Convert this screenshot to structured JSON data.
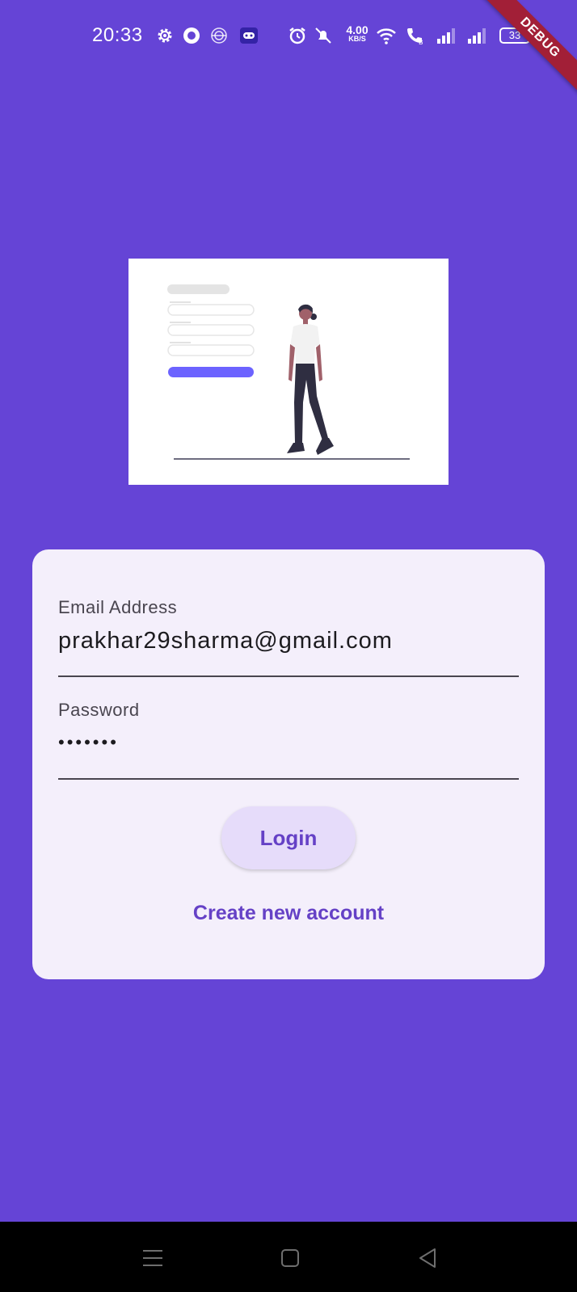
{
  "status_bar": {
    "time": "20:33",
    "net_speed_value": "4.00",
    "net_speed_unit": "KB/S",
    "battery_level": "33",
    "icons": [
      "settings-icon",
      "record-icon",
      "vpn-icon",
      "game-icon",
      "alarm-icon",
      "mute-icon",
      "wifi-icon",
      "call-icon",
      "signal-icon",
      "signal-icon-2",
      "battery-icon"
    ]
  },
  "debug_banner": {
    "label": "DEBUG"
  },
  "login_form": {
    "email_label": "Email Address",
    "email_value": "prakhar29sharma@gmail.com",
    "password_label": "Password",
    "password_value": "•••••••",
    "login_button": "Login",
    "create_account_link": "Create new account"
  },
  "navigation": {
    "buttons": [
      "menu-icon",
      "home-icon",
      "back-icon"
    ]
  },
  "colors": {
    "background": "#6544d6",
    "card": "#f4effb",
    "accent": "#6541c6",
    "button_bg": "#e6dcfa",
    "debug_banner": "#a21f37"
  }
}
